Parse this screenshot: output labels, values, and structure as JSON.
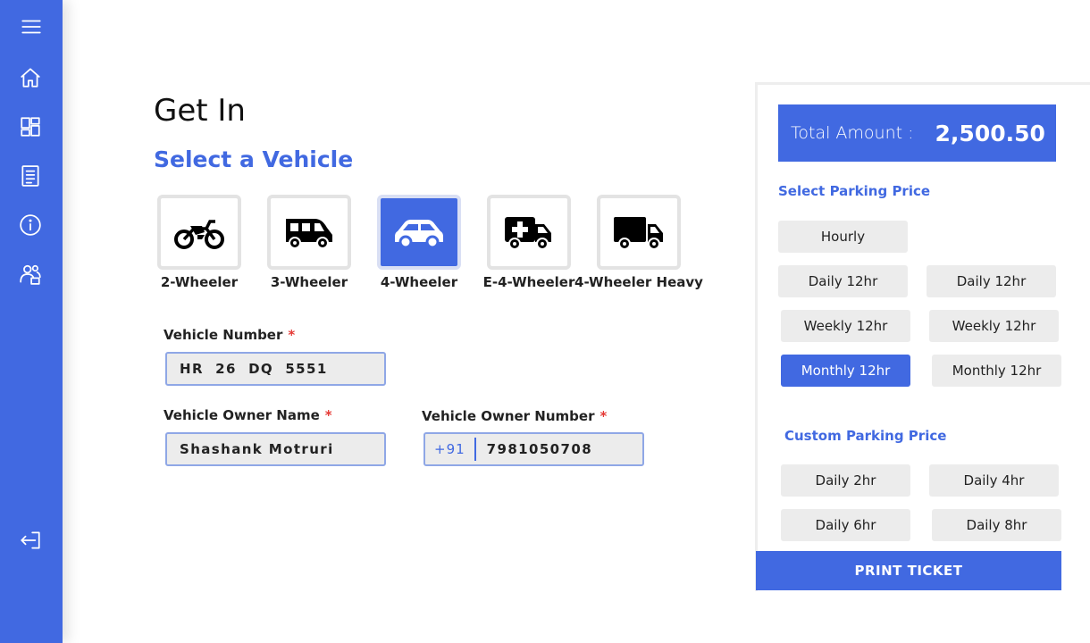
{
  "colors": {
    "accent": "#4169e1",
    "required": "#e53935",
    "button_bg": "#ececec"
  },
  "sidebar": {
    "items": [
      {
        "icon": "menu-icon"
      },
      {
        "icon": "home-icon"
      },
      {
        "icon": "dashboard-icon"
      },
      {
        "icon": "document-icon"
      },
      {
        "icon": "info-icon"
      },
      {
        "icon": "users-icon"
      },
      {
        "icon": "logout-icon"
      }
    ]
  },
  "page": {
    "title": "Get In",
    "section_title": "Select a Vehicle"
  },
  "vehicles": [
    {
      "label": "2-Wheeler",
      "icon": "motorcycle-icon",
      "selected": false
    },
    {
      "label": "3-Wheeler",
      "icon": "three-wheeler-icon",
      "selected": false
    },
    {
      "label": "4-Wheeler",
      "icon": "car-icon",
      "selected": true
    },
    {
      "label": "E-4-Wheeler",
      "icon": "ambulance-icon",
      "selected": false
    },
    {
      "label": "4-Wheeler Heavy",
      "icon": "truck-icon",
      "selected": false
    }
  ],
  "form": {
    "vehicle_number": {
      "label": "Vehicle Number",
      "required_mark": "*",
      "value": "HR  26  DQ  5551"
    },
    "owner_name": {
      "label": "Vehicle Owner Name",
      "required_mark": "*",
      "value": "Shashank Motruri"
    },
    "owner_number": {
      "label": "Vehicle Owner Number",
      "required_mark": "*",
      "prefix": "+91",
      "value": "7981050708"
    }
  },
  "summary": {
    "total_label": "Total Amount  :",
    "total_value": "2,500.50",
    "parking_price_title": "Select Parking Price",
    "parking_options": [
      {
        "label": "Hourly",
        "active": false
      },
      {
        "label": "Daily 12hr",
        "active": false
      },
      {
        "label": "Daily 12hr",
        "active": false
      },
      {
        "label": "Weekly 12hr",
        "active": false
      },
      {
        "label": "Weekly 12hr",
        "active": false
      },
      {
        "label": "Monthly 12hr",
        "active": true
      },
      {
        "label": "Monthly 12hr",
        "active": false
      }
    ],
    "custom_price_title": "Custom Parking Price",
    "custom_options": [
      {
        "label": "Daily 2hr"
      },
      {
        "label": "Daily 4hr"
      },
      {
        "label": "Daily 6hr"
      },
      {
        "label": "Daily 8hr"
      }
    ],
    "print_label": "PRINT TICKET"
  }
}
